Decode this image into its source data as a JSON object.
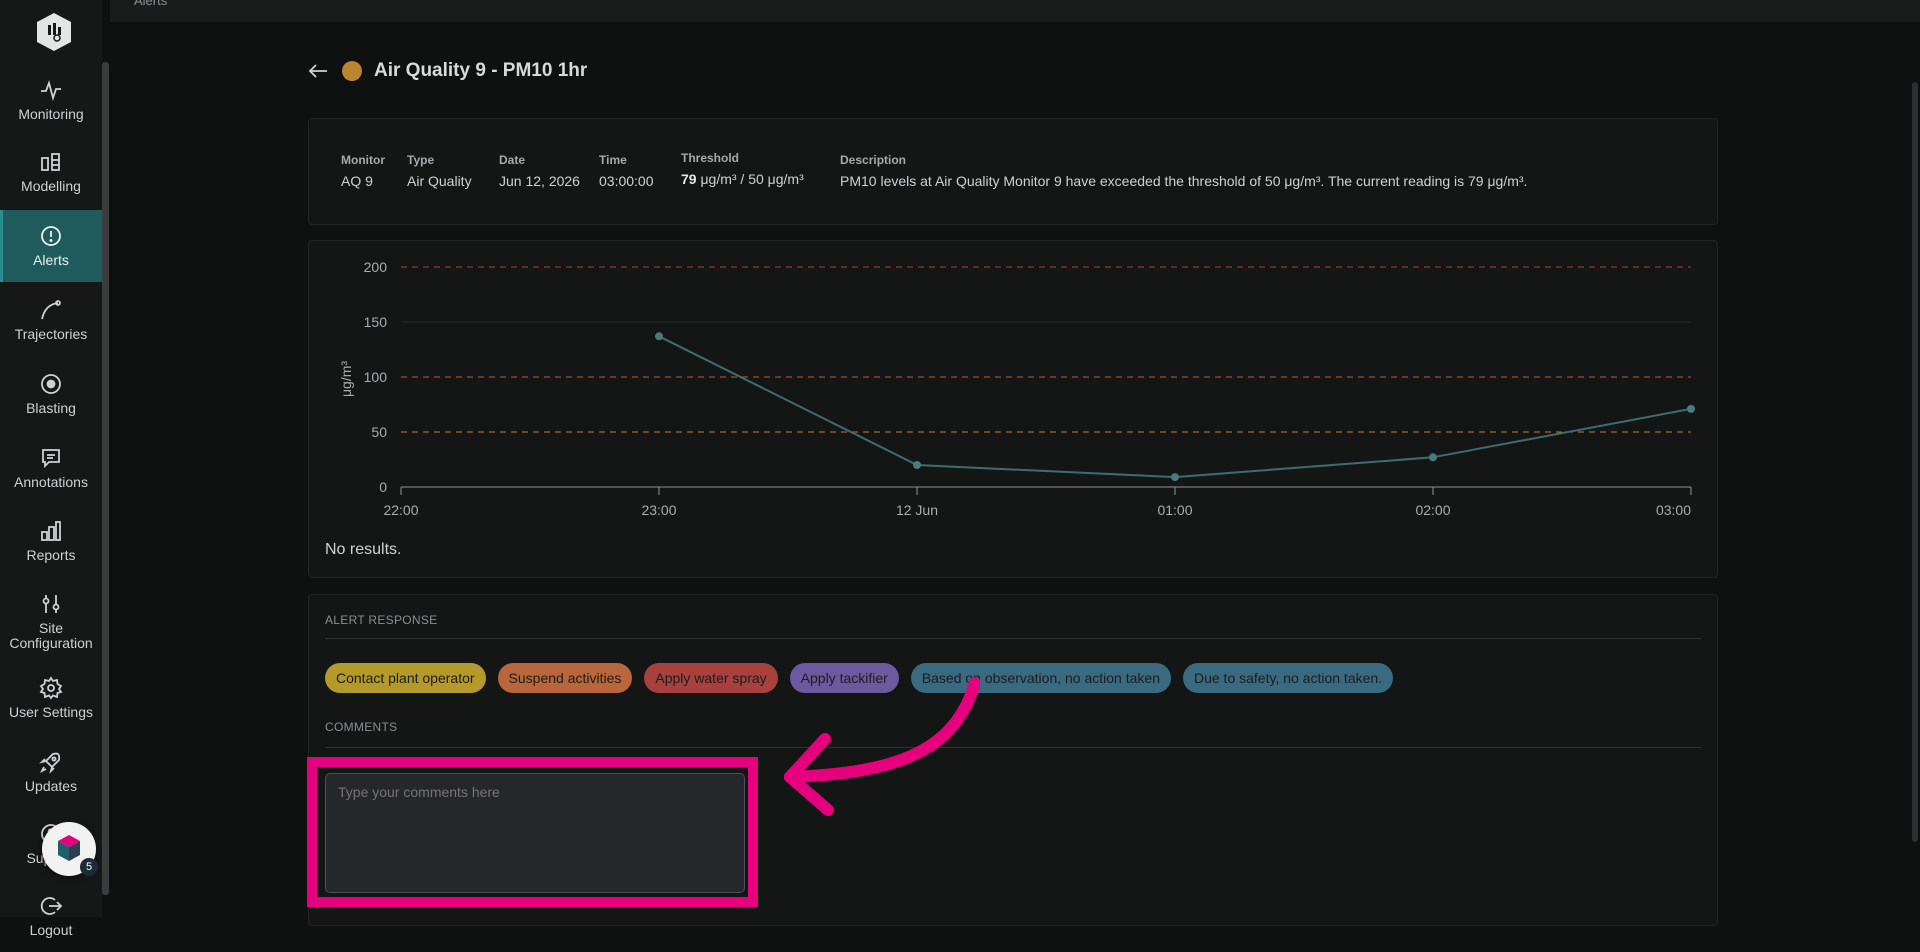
{
  "topbar": {
    "breadcrumb": "Alerts"
  },
  "sidebar": {
    "items": [
      {
        "label": "Monitoring",
        "icon": "activity-icon"
      },
      {
        "label": "Modelling",
        "icon": "model-icon"
      },
      {
        "label": "Alerts",
        "icon": "alert-circle-icon",
        "active": true
      },
      {
        "label": "Trajectories",
        "icon": "trajectory-icon"
      },
      {
        "label": "Blasting",
        "icon": "target-icon"
      },
      {
        "label": "Annotations",
        "icon": "message-icon"
      },
      {
        "label": "Reports",
        "icon": "bar-chart-icon"
      },
      {
        "label": "Site Configuration",
        "icon": "sliders-icon"
      },
      {
        "label": "User Settings",
        "icon": "gear-icon"
      },
      {
        "label": "Updates",
        "icon": "rocket-icon"
      },
      {
        "label": "Support",
        "icon": "help-icon"
      },
      {
        "label": "Logout",
        "icon": "logout-icon"
      }
    ]
  },
  "alert": {
    "title": "Air Quality 9 - PM10 1hr",
    "status_color": "#b8862e",
    "info": {
      "monitor_label": "Monitor",
      "monitor": "AQ 9",
      "type_label": "Type",
      "type": "Air Quality",
      "date_label": "Date",
      "date": "Jun 12, 2026",
      "time_label": "Time",
      "time": "03:00:00",
      "threshold_label": "Threshold",
      "threshold_value": "79",
      "threshold_rest": " μg/m³ / 50 μg/m³",
      "description_label": "Description",
      "description": "PM10 levels at Air Quality Monitor 9 have exceeded the threshold of 50 μg/m³. The current reading is 79 μg/m³."
    },
    "no_results": "No results."
  },
  "chart_data": {
    "type": "line",
    "ylabel": "μg/m³",
    "ylim": [
      0,
      200
    ],
    "yticks": [
      0,
      50,
      100,
      150,
      200
    ],
    "x_ticks": [
      "22:00",
      "23:00",
      "12 Jun",
      "01:00",
      "02:00",
      "03:00"
    ],
    "x": [
      "22:00",
      "23:00",
      "12 Jun",
      "01:00",
      "02:00",
      "03:00"
    ],
    "series": [
      {
        "values": [
          null,
          137,
          20,
          9,
          27,
          71
        ],
        "color": "#3e6d6e"
      }
    ],
    "threshold_lines": [
      {
        "value": 200,
        "color": "#b83a3a"
      },
      {
        "value": 100,
        "color": "#b8602e"
      },
      {
        "value": 50,
        "color": "#c77a2a"
      }
    ]
  },
  "response": {
    "section_label": "ALERT RESPONSE",
    "actions": [
      {
        "label": "Contact plant operator",
        "color": "#b49a2a"
      },
      {
        "label": "Suspend activities",
        "color": "#b8663a"
      },
      {
        "label": "Apply water spray",
        "color": "#a8403e"
      },
      {
        "label": "Apply tackifier",
        "color": "#6b5aa0"
      },
      {
        "label": "Based on observation, no action taken",
        "color": "#3a6a80"
      },
      {
        "label": "Due to safety, no action taken.",
        "color": "#3a6a80"
      }
    ],
    "comments_label": "COMMENTS",
    "comments_placeholder": "Type your comments here"
  },
  "help_widget": {
    "badge": "5"
  },
  "annotation": {
    "highlight_color": "#e6007e"
  }
}
